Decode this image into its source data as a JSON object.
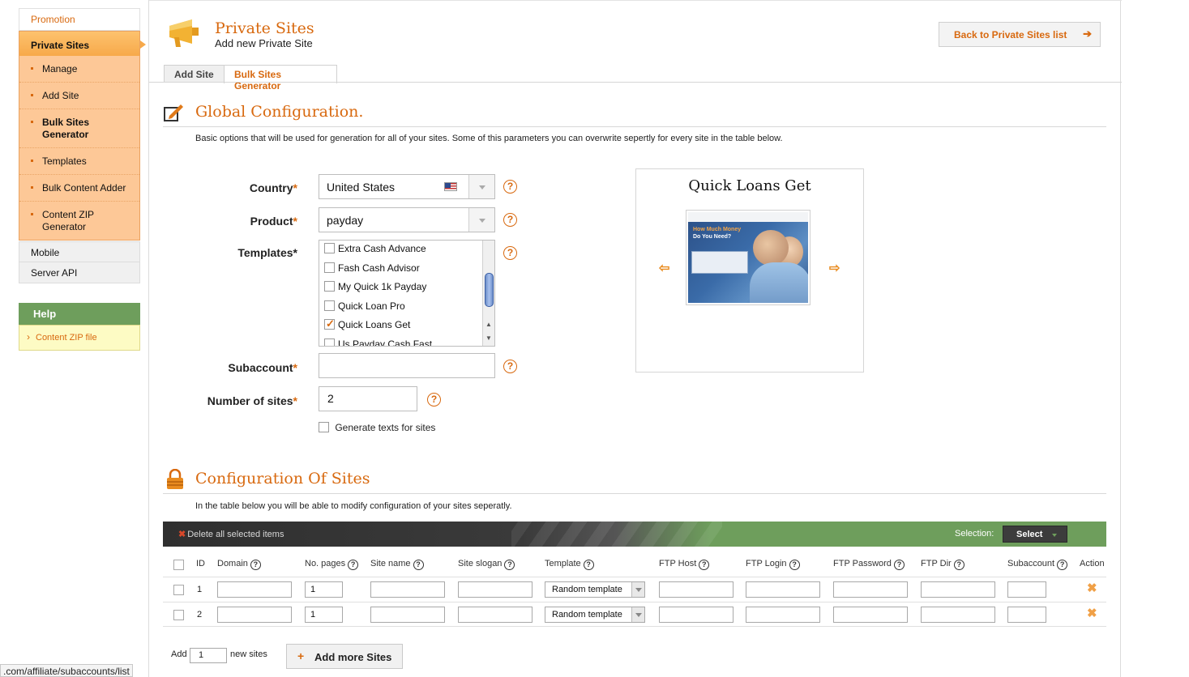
{
  "sidebar": {
    "promotion": "Promotion",
    "private_sites": "Private Sites",
    "items": [
      {
        "label": "Manage"
      },
      {
        "label": "Add Site"
      },
      {
        "label": "Bulk Sites Generator"
      },
      {
        "label": "Templates"
      },
      {
        "label": "Bulk Content Adder"
      },
      {
        "label": "Content ZIP Generator"
      }
    ],
    "mobile": "Mobile",
    "server_api": "Server API",
    "help": {
      "title": "Help",
      "link": "Content ZIP file"
    }
  },
  "page": {
    "title": "Private Sites",
    "subtitle": "Add new Private Site",
    "back_button": "Back to Private Sites list",
    "tabs": [
      "Add Site",
      "Bulk Sites Generator"
    ],
    "active_tab": "Bulk Sites Generator"
  },
  "global": {
    "title": "Global Configuration.",
    "description": "Basic options that will be used for generation for all of your sites. Some of this parameters you can overwrite sepertly for every site in the table below.",
    "country_label": "Country",
    "country_value": "United States",
    "product_label": "Product",
    "product_value": "payday",
    "templates_label": "Templates*",
    "templates": [
      {
        "label": "Extra Cash Advance",
        "checked": false
      },
      {
        "label": "Fash Cash Advisor",
        "checked": false
      },
      {
        "label": "My Quick 1k Payday",
        "checked": false
      },
      {
        "label": "Quick Loan Pro",
        "checked": false
      },
      {
        "label": "Quick Loans Get",
        "checked": true
      },
      {
        "label": "Us Payday Cash Fast",
        "checked": false
      }
    ],
    "subaccount_label": "Subaccount",
    "subaccount_value": "",
    "num_sites_label": "Number of sites",
    "num_sites_value": "2",
    "generate_texts_label": "Generate texts for sites",
    "help_glyph": "?",
    "required_mark": "*"
  },
  "preview": {
    "title": "Quick Loans Get",
    "image_headline_1": "How Much Money",
    "image_headline_2": "Do You Need?",
    "prev_icon": "arrow-left-icon",
    "next_icon": "arrow-right-icon"
  },
  "sites": {
    "title": "Configuration Of Sites",
    "description": "In the table below you will be able to modify configuration of your sites seperatly.",
    "delete_all": "Delete all selected items",
    "selection_label": "Selection:",
    "select_button": "Select",
    "columns": [
      "ID",
      "Domain",
      "No. pages",
      "Site name",
      "Site slogan",
      "Template",
      "FTP Host",
      "FTP Login",
      "FTP Password",
      "FTP Dir",
      "Subaccount",
      "Action"
    ],
    "rows": [
      {
        "id": "1",
        "pages": "1",
        "template": "Random template"
      },
      {
        "id": "2",
        "pages": "1",
        "template": "Random template"
      }
    ],
    "add_label": "Add",
    "add_count": "1",
    "new_sites_label": "new sites",
    "add_more_button": "Add more Sites"
  },
  "status_url": ".com/affiliate/subaccounts/list",
  "colors": {
    "accent": "#d8690f",
    "sidebar_active": "#fbb65c",
    "help_green": "#6e9e5c"
  }
}
